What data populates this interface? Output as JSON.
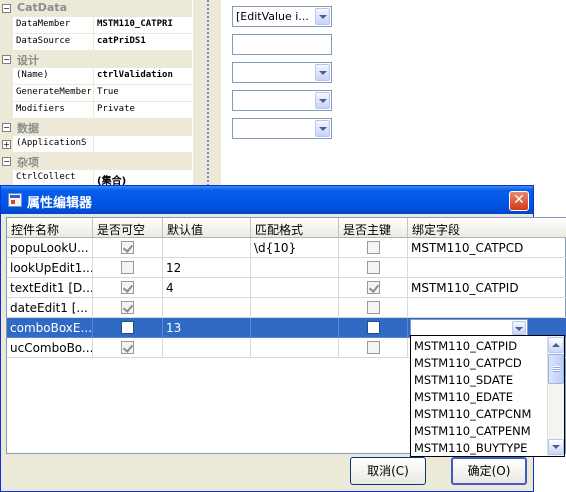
{
  "property_grid": {
    "rows": [
      {
        "kind": "category",
        "label": "CatData"
      },
      {
        "kind": "prop",
        "name": "DataMember",
        "value": "MSTM110_CATPRI",
        "bold": true
      },
      {
        "kind": "prop",
        "name": "DataSource",
        "value": "catPriDS1",
        "bold": true
      },
      {
        "kind": "category",
        "label": "设计"
      },
      {
        "kind": "prop",
        "name": "(Name)",
        "value": "ctrlValidation",
        "bold": true
      },
      {
        "kind": "prop",
        "name": "GenerateMember",
        "value": "True",
        "bold": false
      },
      {
        "kind": "prop",
        "name": "Modifiers",
        "value": "Private",
        "bold": false
      },
      {
        "kind": "category",
        "label": "数据"
      },
      {
        "kind": "prop-expand",
        "name": "(ApplicationS",
        "value": "",
        "bold": false
      },
      {
        "kind": "category",
        "label": "杂项"
      },
      {
        "kind": "prop",
        "name": "CtrlCollect",
        "value": "(集合)",
        "bold": true
      }
    ]
  },
  "designer": {
    "fields": [
      {
        "text": "[EditValue i...",
        "dropdown": true
      },
      {
        "text": "",
        "dropdown": false
      },
      {
        "text": "",
        "dropdown": true
      },
      {
        "text": "",
        "dropdown": true
      },
      {
        "text": "",
        "dropdown": true
      }
    ]
  },
  "dialog": {
    "title": "属性编辑器",
    "close_label": "✕",
    "columns": [
      "控件名称",
      "是否可空",
      "默认值",
      "匹配格式",
      "是否主键",
      "绑定字段"
    ],
    "rows": [
      {
        "name": "popuLookU...",
        "nullable": true,
        "default": "",
        "pattern": "\\d{10}",
        "primary": false,
        "field": "MSTM110_CATPCD",
        "selected": false
      },
      {
        "name": "lookUpEdit1...",
        "nullable": false,
        "default": "12",
        "pattern": "",
        "primary": false,
        "field": "",
        "selected": false
      },
      {
        "name": "textEdit1 [D...",
        "nullable": true,
        "default": "4",
        "pattern": "",
        "primary": true,
        "field": "MSTM110_CATPID",
        "selected": false
      },
      {
        "name": "dateEdit1 [...",
        "nullable": true,
        "default": "",
        "pattern": "",
        "primary": false,
        "field": "",
        "selected": false
      },
      {
        "name": "comboBoxE...",
        "nullable": false,
        "default": "13",
        "pattern": "",
        "primary": false,
        "field": "",
        "selected": true
      },
      {
        "name": "ucComboBo...",
        "nullable": true,
        "default": "",
        "pattern": "",
        "primary": false,
        "field": "",
        "selected": false
      }
    ],
    "dropdown_items": [
      "MSTM110_CATPID",
      "MSTM110_CATPCD",
      "MSTM110_SDATE",
      "MSTM110_EDATE",
      "MSTM110_CATPCNM",
      "MSTM110_CATPENM",
      "MSTM110_BUYTYPE"
    ],
    "cancel_label": "取消(C)",
    "ok_label": "确定(O)"
  },
  "colors": {
    "title_bar": "#0055e5",
    "selection": "#316ac5",
    "check_mark": "#21a121",
    "close_button": "#d5381a"
  }
}
